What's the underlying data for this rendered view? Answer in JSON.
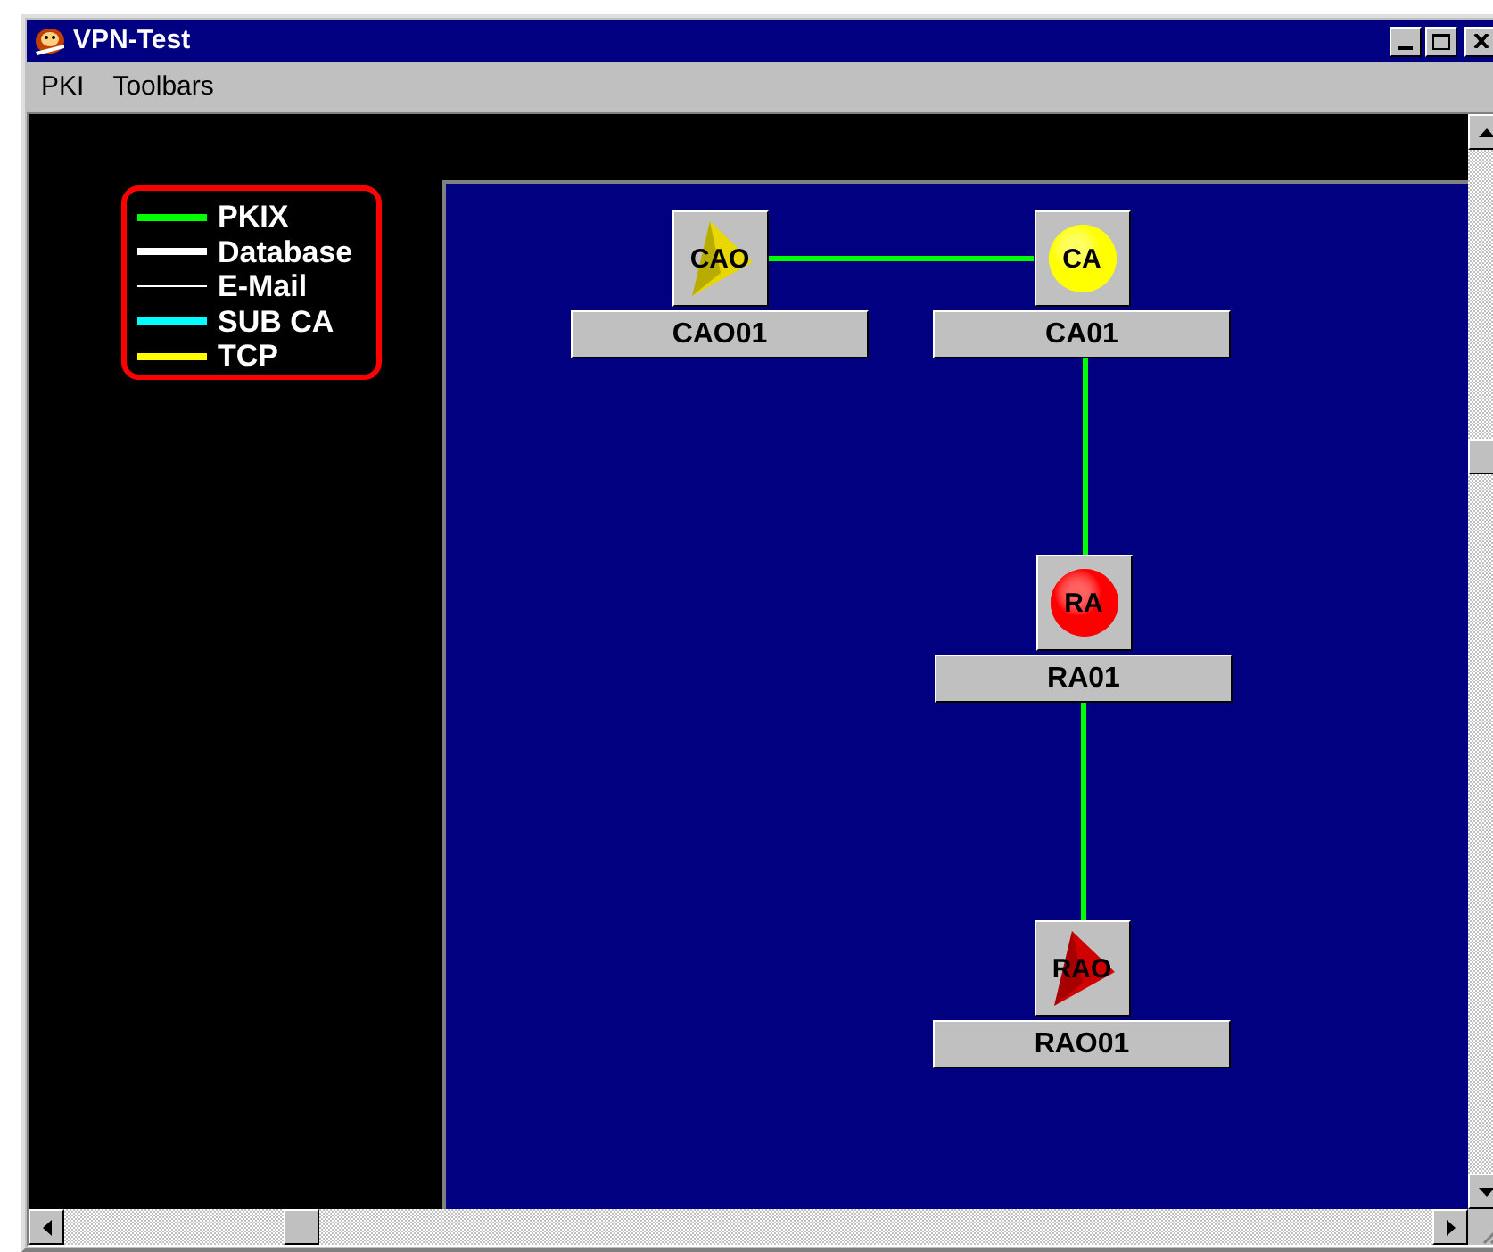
{
  "window": {
    "title": "VPN-Test"
  },
  "menu": [
    {
      "label": "PKI"
    },
    {
      "label": "Toolbars"
    }
  ],
  "legend": [
    {
      "label": "PKIX",
      "color": "#00ff00",
      "kind": "thick"
    },
    {
      "label": "Database",
      "color": "#ffffff",
      "kind": "thick"
    },
    {
      "label": "E-Mail",
      "color": "#ffffff",
      "kind": "thin"
    },
    {
      "label": "SUB CA",
      "color": "#00ffff",
      "kind": "thick"
    },
    {
      "label": "TCP",
      "color": "#ffff00",
      "kind": "thick"
    }
  ],
  "nodes": [
    {
      "label": "CAO01",
      "badge": "CAO",
      "kind": "pyramid",
      "color": "#e8d800"
    },
    {
      "label": "CA01",
      "badge": "CA",
      "kind": "sphere",
      "color": "#ffff00",
      "link": {
        "kind": "pkix"
      }
    },
    {
      "label": "RA01",
      "badge": "RA",
      "kind": "sphere",
      "color": "#ff0000",
      "link": {
        "kind": "pkix"
      }
    },
    {
      "label": "RAO01",
      "badge": "RAO",
      "kind": "pyramid",
      "color": "#d00000",
      "link": {
        "kind": "pkix"
      }
    }
  ]
}
